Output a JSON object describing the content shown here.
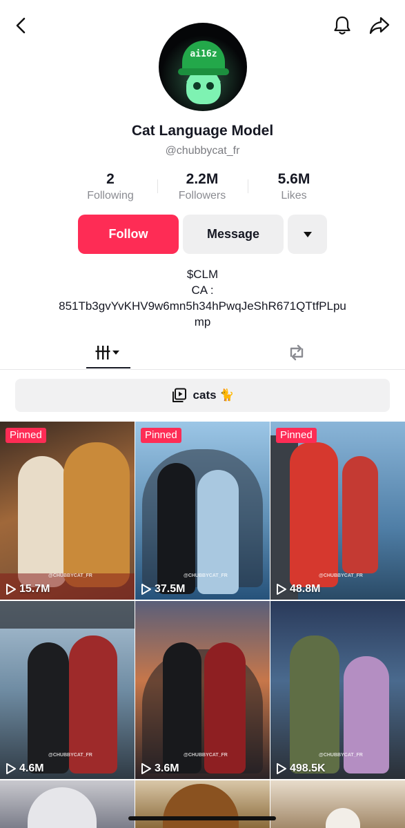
{
  "profile": {
    "name": "Cat Language Model",
    "handle": "@chubbycat_fr",
    "avatar_cap_text": "ai16z"
  },
  "stats": [
    {
      "value": "2",
      "label": "Following"
    },
    {
      "value": "2.2M",
      "label": "Followers"
    },
    {
      "value": "5.6M",
      "label": "Likes"
    }
  ],
  "actions": {
    "follow": "Follow",
    "message": "Message"
  },
  "bio": {
    "line1": "$CLM",
    "line2": "CA :",
    "line3": "851Tb3gvYvKHV9w6mn5h34hPwqJeShR671QTtfPLpu",
    "line4": "mp"
  },
  "playlist": {
    "label": "cats 🐈"
  },
  "videos": [
    {
      "badge": "Pinned",
      "views": "15.7M",
      "watermark": "@CHUBBYCAT_FR"
    },
    {
      "badge": "Pinned",
      "views": "37.5M",
      "watermark": "@CHUBBYCAT_FR"
    },
    {
      "badge": "Pinned",
      "views": "48.8M",
      "watermark": "@CHUBBYCAT_FR"
    },
    {
      "views": "4.6M",
      "watermark": "@CHUBBYCAT_FR"
    },
    {
      "views": "3.6M",
      "watermark": "@CHUBBYCAT_FR"
    },
    {
      "views": "498.5K",
      "watermark": "@CHUBBYCAT_FR"
    }
  ],
  "icons": {
    "back": "chevron-left-icon",
    "notifications": "bell-icon",
    "share": "share-arrow-icon",
    "videos_tab": "grid-bars-icon",
    "reposts_tab": "repost-icon",
    "playlist": "playlist-icon",
    "play": "play-icon"
  },
  "colors": {
    "accent": "#fe2c55",
    "secondary_button": "#efeff0",
    "text": "#161823",
    "muted": "#8a8b91"
  }
}
